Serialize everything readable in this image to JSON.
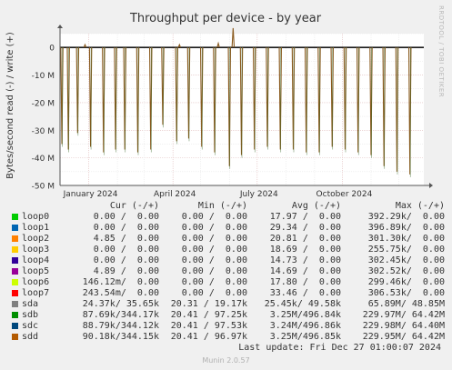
{
  "chart_data": {
    "type": "line",
    "title": "Throughput per device - by year",
    "ylabel": "Bytes/second read (-) / write (+)",
    "ylim": [
      -50,
      5
    ],
    "y_ticks": [
      {
        "value": 0,
        "label": "0"
      },
      {
        "value": -10,
        "label": "-10 M"
      },
      {
        "value": -20,
        "label": "-20 M"
      },
      {
        "value": -30,
        "label": "-30 M"
      },
      {
        "value": -40,
        "label": "-40 M"
      },
      {
        "value": -50,
        "label": "-50 M"
      }
    ],
    "x_range": [
      "2023-12-01",
      "2024-12-28"
    ],
    "x_ticks": [
      {
        "date": "2024-01-01",
        "label": "January 2024"
      },
      {
        "date": "2024-04-01",
        "label": "April 2024"
      },
      {
        "date": "2024-07-01",
        "label": "July 2024"
      },
      {
        "date": "2024-10-01",
        "label": "October 2024"
      }
    ],
    "grid": true,
    "series_read_spikes": [
      {
        "date": "2023-12-03",
        "value": -35
      },
      {
        "date": "2023-12-10",
        "value": -37
      },
      {
        "date": "2023-12-20",
        "value": -31
      },
      {
        "date": "2024-01-03",
        "value": -36
      },
      {
        "date": "2024-01-17",
        "value": -38
      },
      {
        "date": "2024-01-30",
        "value": -37
      },
      {
        "date": "2024-02-09",
        "value": -37
      },
      {
        "date": "2024-02-23",
        "value": -38
      },
      {
        "date": "2024-03-08",
        "value": -37
      },
      {
        "date": "2024-03-21",
        "value": -28
      },
      {
        "date": "2024-04-05",
        "value": -34
      },
      {
        "date": "2024-04-18",
        "value": -33
      },
      {
        "date": "2024-05-02",
        "value": -36
      },
      {
        "date": "2024-05-16",
        "value": -38
      },
      {
        "date": "2024-06-01",
        "value": -43
      },
      {
        "date": "2024-06-14",
        "value": -39
      },
      {
        "date": "2024-06-28",
        "value": -37
      },
      {
        "date": "2024-07-12",
        "value": -36
      },
      {
        "date": "2024-07-26",
        "value": -37
      },
      {
        "date": "2024-08-09",
        "value": -37
      },
      {
        "date": "2024-08-23",
        "value": -38
      },
      {
        "date": "2024-09-06",
        "value": -38
      },
      {
        "date": "2024-09-20",
        "value": -36
      },
      {
        "date": "2024-10-04",
        "value": -37
      },
      {
        "date": "2024-10-18",
        "value": -38
      },
      {
        "date": "2024-11-01",
        "value": -39
      },
      {
        "date": "2024-11-15",
        "value": -43
      },
      {
        "date": "2024-11-29",
        "value": -45
      },
      {
        "date": "2024-12-13",
        "value": -46
      }
    ],
    "series_write_peaks": [
      {
        "date": "2024-06-05",
        "value": 7
      },
      {
        "date": "2024-05-20",
        "value": 1.5
      },
      {
        "date": "2024-04-08",
        "value": 1
      },
      {
        "date": "2023-12-28",
        "value": 1
      }
    ],
    "series": [
      {
        "name": "loop0",
        "color": "#00cc00"
      },
      {
        "name": "loop1",
        "color": "#0066b3"
      },
      {
        "name": "loop2",
        "color": "#ff8000"
      },
      {
        "name": "loop3",
        "color": "#ffcc00"
      },
      {
        "name": "loop4",
        "color": "#330099"
      },
      {
        "name": "loop5",
        "color": "#990099"
      },
      {
        "name": "loop6",
        "color": "#ccff00"
      },
      {
        "name": "loop7",
        "color": "#ff0000"
      },
      {
        "name": "sda",
        "color": "#808080"
      },
      {
        "name": "sdb",
        "color": "#008f00"
      },
      {
        "name": "sdc",
        "color": "#00487d"
      },
      {
        "name": "sdd",
        "color": "#b35a00"
      }
    ]
  },
  "legend": {
    "headers": {
      "cur": "Cur (-/+)",
      "min": "Min (-/+)",
      "avg": "Avg (-/+)",
      "max": "Max (-/+)"
    },
    "rows": [
      {
        "name": "loop0",
        "cur": "0.00 /  0.00",
        "min": "0.00 /  0.00",
        "avg": "17.97 /  0.00",
        "max": "392.29k/  0.00"
      },
      {
        "name": "loop1",
        "cur": "0.00 /  0.00",
        "min": "0.00 /  0.00",
        "avg": "29.34 /  0.00",
        "max": "396.89k/  0.00"
      },
      {
        "name": "loop2",
        "cur": "4.85 /  0.00",
        "min": "0.00 /  0.00",
        "avg": "20.81 /  0.00",
        "max": "301.30k/  0.00"
      },
      {
        "name": "loop3",
        "cur": "0.00 /  0.00",
        "min": "0.00 /  0.00",
        "avg": "18.69 /  0.00",
        "max": "255.75k/  0.00"
      },
      {
        "name": "loop4",
        "cur": "0.00 /  0.00",
        "min": "0.00 /  0.00",
        "avg": "14.73 /  0.00",
        "max": "302.45k/  0.00"
      },
      {
        "name": "loop5",
        "cur": "4.89 /  0.00",
        "min": "0.00 /  0.00",
        "avg": "14.69 /  0.00",
        "max": "302.52k/  0.00"
      },
      {
        "name": "loop6",
        "cur": "146.12m/  0.00",
        "min": "0.00 /  0.00",
        "avg": "17.80 /  0.00",
        "max": "299.46k/  0.00"
      },
      {
        "name": "loop7",
        "cur": "243.54m/  0.00",
        "min": "0.00 /  0.00",
        "avg": "33.46 /  0.00",
        "max": "306.53k/  0.00"
      },
      {
        "name": "sda",
        "cur": "24.37k/ 35.65k",
        "min": "20.31 / 19.17k",
        "avg": "25.45k/ 49.58k",
        "max": "65.89M/ 48.85M"
      },
      {
        "name": "sdb",
        "cur": "87.69k/344.17k",
        "min": "20.41 / 97.25k",
        "avg": "3.25M/496.84k",
        "max": "229.97M/ 64.42M"
      },
      {
        "name": "sdc",
        "cur": "88.79k/344.12k",
        "min": "20.41 / 97.53k",
        "avg": "3.24M/496.86k",
        "max": "229.98M/ 64.40M"
      },
      {
        "name": "sdd",
        "cur": "90.18k/344.15k",
        "min": "20.41 / 96.97k",
        "avg": "3.25M/496.85k",
        "max": "229.95M/ 64.42M"
      }
    ]
  },
  "footer": {
    "last_update": "Last update: Fri Dec 27 01:00:07 2024",
    "munin_version": "Munin 2.0.57",
    "watermark": "RRDTOOL / TOBI OETIKER"
  }
}
